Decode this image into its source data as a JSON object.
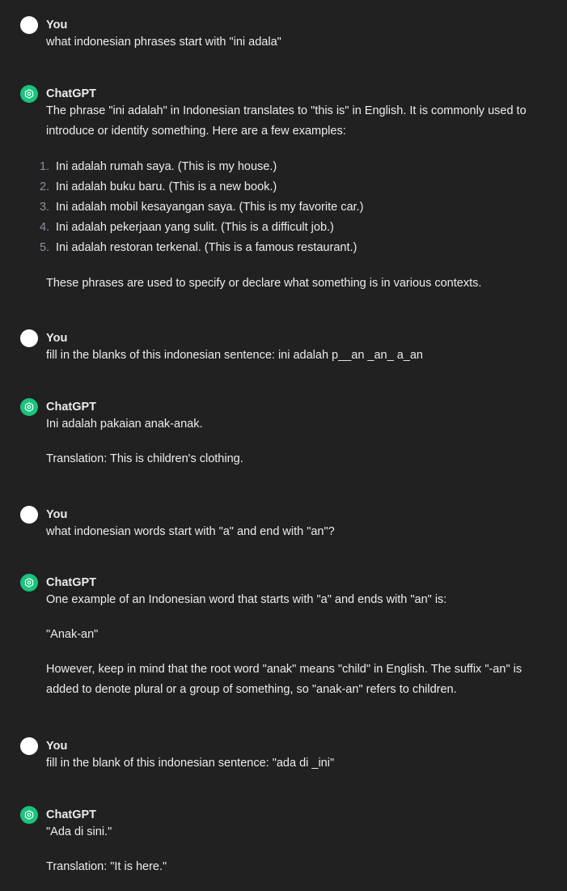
{
  "conversation": {
    "messages": [
      {
        "author": "You",
        "text": "what indonesian phrases start with \"ini adala\""
      },
      {
        "author": "ChatGPT",
        "intro": "The phrase \"ini adalah\" in Indonesian translates to \"this is\" in English. It is commonly used to introduce or identify something. Here are a few examples:",
        "list": [
          {
            "num": "1.",
            "text": "Ini adalah rumah saya. (This is my house.)"
          },
          {
            "num": "2.",
            "text": "Ini adalah buku baru. (This is a new book.)"
          },
          {
            "num": "3.",
            "text": "Ini adalah mobil kesayangan saya. (This is my favorite car.)"
          },
          {
            "num": "4.",
            "text": "Ini adalah pekerjaan yang sulit. (This is a difficult job.)"
          },
          {
            "num": "5.",
            "text": "Ini adalah restoran terkenal. (This is a famous restaurant.)"
          }
        ],
        "outro": "These phrases are used to specify or declare what something is in various contexts."
      },
      {
        "author": "You",
        "text": "fill in the blanks of this indonesian sentence: ini adalah p__an _an_ a_an"
      },
      {
        "author": "ChatGPT",
        "p1": "Ini adalah pakaian anak-anak.",
        "p2": "Translation: This is children's clothing."
      },
      {
        "author": "You",
        "text": "what indonesian words start with \"a\" and end with \"an\"?"
      },
      {
        "author": "ChatGPT",
        "p1": "One example of an Indonesian word that starts with \"a\" and ends with \"an\" is:",
        "p2": "\"Anak-an\"",
        "p3": "However, keep in mind that the root word \"anak\" means \"child\" in English. The suffix \"-an\" is added to denote plural or a group of something, so \"anak-an\" refers to children."
      },
      {
        "author": "You",
        "text": "fill in the blank of this indonesian sentence: \"ada di _ini\""
      },
      {
        "author": "ChatGPT",
        "p1": "\"Ada di sini.\"",
        "p2": "Translation: \"It is here.\""
      }
    ]
  },
  "colors": {
    "background": "#212121",
    "text": "#ececec",
    "list_number": "#8e8ea0",
    "gpt_avatar": "#19c37d",
    "user_avatar": "#ffffff"
  },
  "icons": {
    "user_avatar": "user-avatar-icon",
    "gpt_avatar": "openai-logo-icon"
  }
}
